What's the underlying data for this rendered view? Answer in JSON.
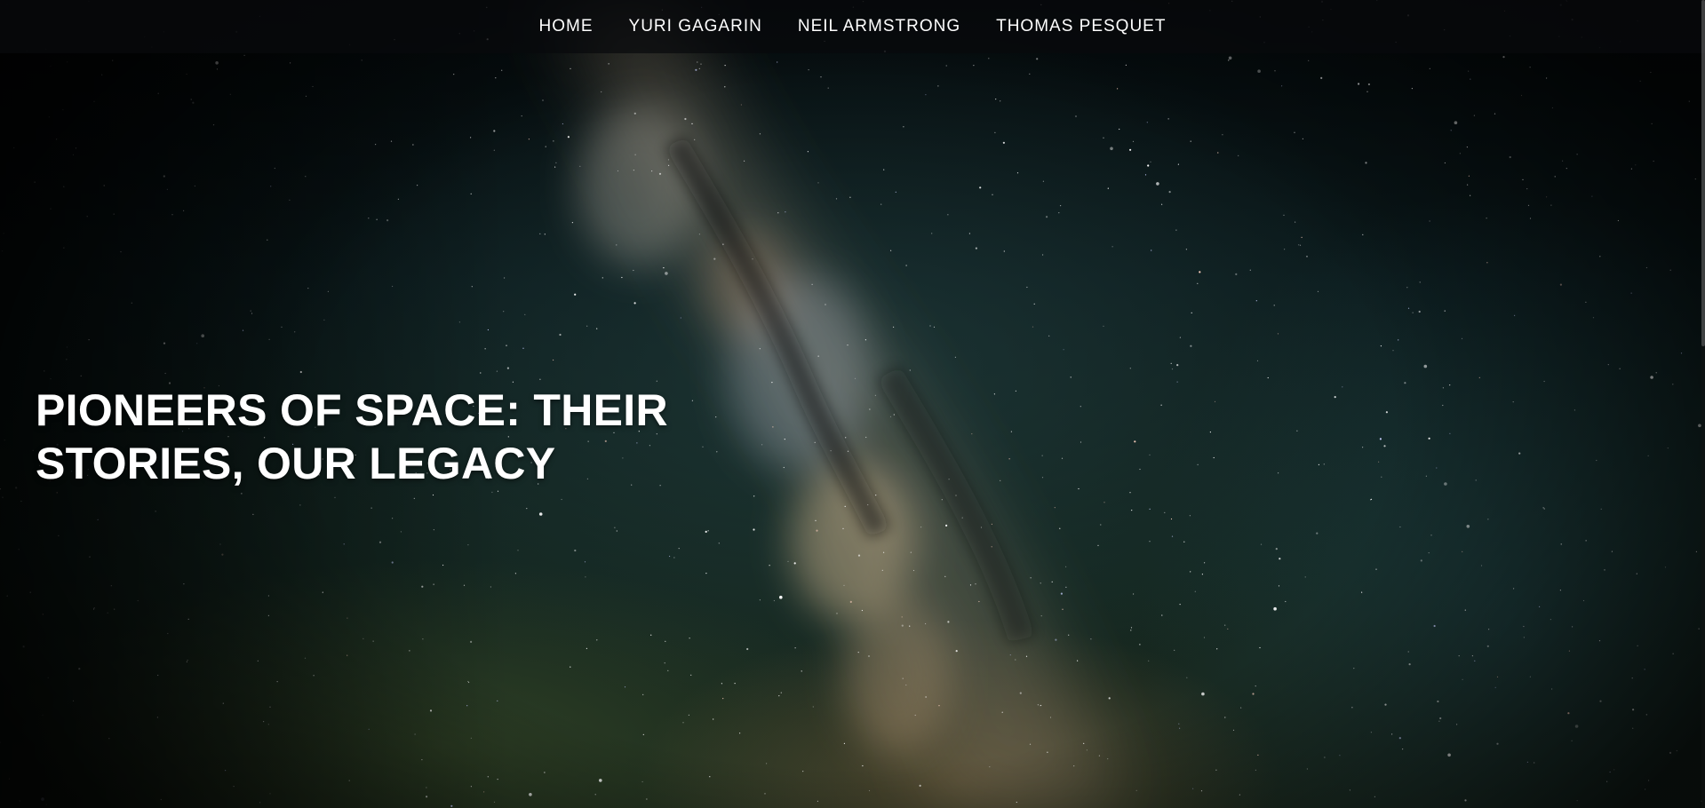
{
  "nav": {
    "items": [
      {
        "label": "HOME"
      },
      {
        "label": "YURI GAGARIN"
      },
      {
        "label": "NEIL ARMSTRONG"
      },
      {
        "label": "THOMAS PESQUET"
      }
    ]
  },
  "hero": {
    "background": "milky-way-night-sky-photo",
    "title_line1": "PIONEERS OF SPACE: THEIR",
    "title_line2": "STORIES, OUR LEGACY"
  },
  "colors": {
    "nav_bg": "#080a0c",
    "text": "#ffffff",
    "sky_dark": "#04090b"
  }
}
